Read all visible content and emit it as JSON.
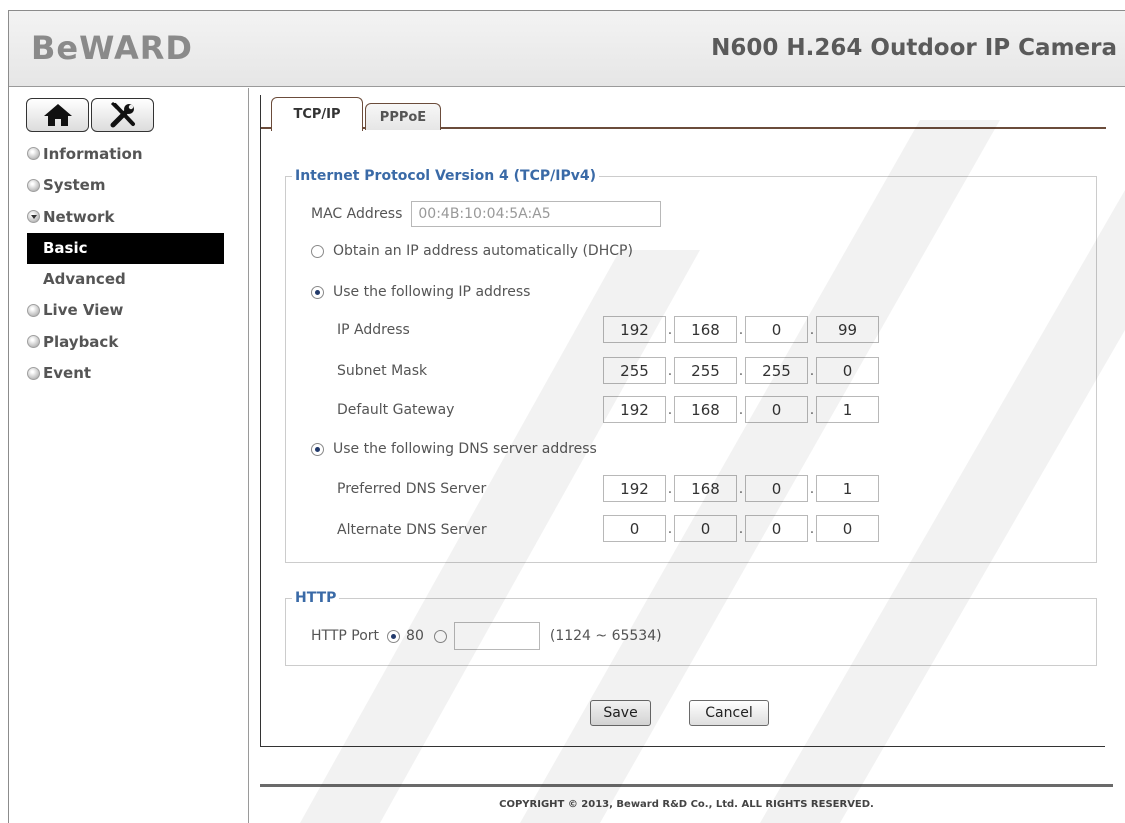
{
  "header": {
    "logo": "BeWARD",
    "product_title": "N600 H.264 Outdoor IP Camera"
  },
  "toolbar": {
    "home_icon": "home-icon",
    "settings_icon": "tools-icon"
  },
  "sidebar": {
    "items": [
      {
        "label": "Information"
      },
      {
        "label": "System"
      },
      {
        "label": "Network"
      },
      {
        "label": "Live View"
      },
      {
        "label": "Playback"
      },
      {
        "label": "Event"
      }
    ],
    "network_sub": [
      {
        "label": "Basic",
        "active": true
      },
      {
        "label": "Advanced"
      }
    ]
  },
  "tabs": [
    {
      "label": "TCP/IP",
      "active": true
    },
    {
      "label": "PPPoE"
    }
  ],
  "ipv4": {
    "legend": "Internet Protocol Version 4 (TCP/IPv4)",
    "mac_label": "MAC Address",
    "mac_value": "00:4B:10:04:5A:A5",
    "dhcp_label": "Obtain an IP address automatically (DHCP)",
    "static_label": "Use the following IP address",
    "ip_label": "IP Address",
    "ip": [
      "192",
      "168",
      "0",
      "99"
    ],
    "mask_label": "Subnet Mask",
    "mask": [
      "255",
      "255",
      "255",
      "0"
    ],
    "gw_label": "Default Gateway",
    "gw": [
      "192",
      "168",
      "0",
      "1"
    ],
    "dns_label": "Use the following DNS server address",
    "dns1_label": "Preferred DNS Server",
    "dns1": [
      "192",
      "168",
      "0",
      "1"
    ],
    "dns2_label": "Alternate DNS Server",
    "dns2": [
      "0",
      "0",
      "0",
      "0"
    ]
  },
  "http": {
    "legend": "HTTP",
    "port_label": "HTTP Port",
    "default_port": "80",
    "custom_port": "",
    "range": "(1124 ~ 65534)"
  },
  "buttons": {
    "save": "Save",
    "cancel": "Cancel"
  },
  "footer": {
    "copyright": "COPYRIGHT © 2013, Beward R&D Co., Ltd. ALL RIGHTS RESERVED."
  },
  "colors": {
    "legend_blue": "#3a6aa7",
    "active_nav_bg": "#000000",
    "tab_border": "#6b4c3b"
  }
}
